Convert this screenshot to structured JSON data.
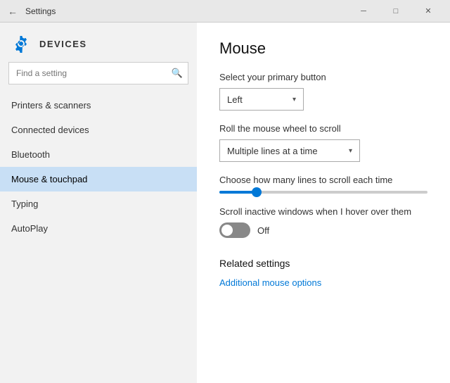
{
  "titlebar": {
    "title": "Settings",
    "back_label": "←",
    "minimize_label": "─",
    "maximize_label": "□",
    "close_label": "✕"
  },
  "sidebar": {
    "gear_icon": "⚙",
    "section_title": "DEVICES",
    "search_placeholder": "Find a setting",
    "search_icon": "🔍",
    "nav_items": [
      {
        "label": "Printers & scanners",
        "active": false
      },
      {
        "label": "Connected devices",
        "active": false
      },
      {
        "label": "Bluetooth",
        "active": false
      },
      {
        "label": "Mouse & touchpad",
        "active": true
      },
      {
        "label": "Typing",
        "active": false
      },
      {
        "label": "AutoPlay",
        "active": false
      }
    ]
  },
  "content": {
    "title": "Mouse",
    "primary_button_label": "Select your primary button",
    "primary_button_value": "Left",
    "scroll_label": "Roll the mouse wheel to scroll",
    "scroll_value": "Multiple lines at a time",
    "lines_label": "Choose how many lines to scroll each time",
    "slider_percent": 18,
    "scroll_inactive_label": "Scroll inactive windows when I hover over them",
    "toggle_state": "Off",
    "related_title": "Related settings",
    "additional_mouse_link": "Additional mouse options"
  }
}
